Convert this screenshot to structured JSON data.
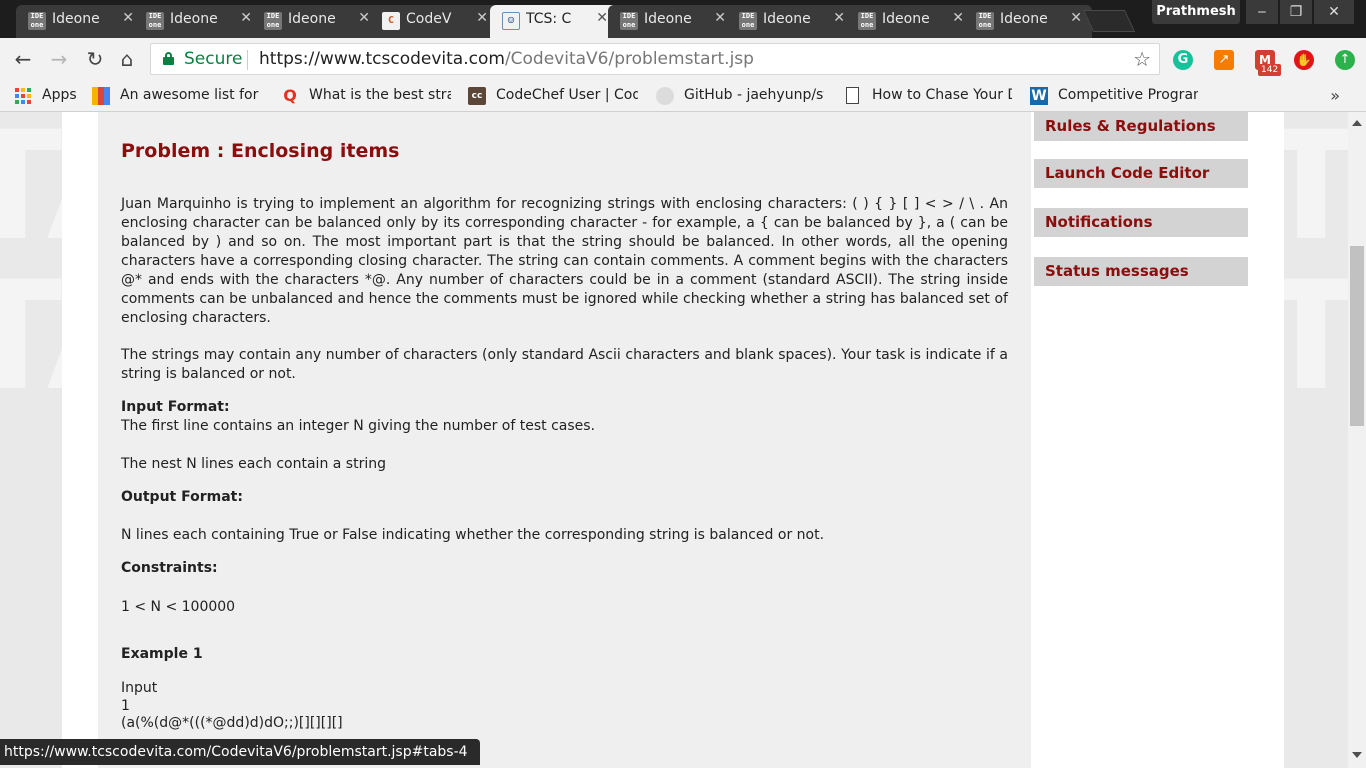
{
  "browser": {
    "tabs": [
      {
        "title": "Ideone",
        "favicon": "ideone-icon",
        "favicon_text": "IDE one",
        "active": false
      },
      {
        "title": "Ideone",
        "favicon": "ideone-icon",
        "favicon_text": "IDE one",
        "active": false
      },
      {
        "title": "Ideone",
        "favicon": "ideone-icon",
        "favicon_text": "IDE one",
        "active": false
      },
      {
        "title": "CodeV",
        "favicon": "codechef-icon",
        "favicon_text": "C",
        "active": false
      },
      {
        "title": "TCS: C",
        "favicon": "tcs-icon",
        "favicon_text": "☺",
        "active": true
      },
      {
        "title": "Ideone",
        "favicon": "ideone-icon",
        "favicon_text": "IDE one",
        "active": false
      },
      {
        "title": "Ideone",
        "favicon": "ideone-icon",
        "favicon_text": "IDE one",
        "active": false
      },
      {
        "title": "Ideone",
        "favicon": "ideone-icon",
        "favicon_text": "IDE one",
        "active": false
      },
      {
        "title": "Ideone",
        "favicon": "ideone-icon",
        "favicon_text": "IDE one",
        "active": false
      }
    ],
    "profile_name": "Prathmesh",
    "window_controls": {
      "minimize": "‒",
      "maximize": "❐",
      "close": "✕"
    },
    "toolbar": {
      "secure_label": "Secure",
      "url_host": "https://www.tcscodevita.com",
      "url_path": "/CodevitaV6/problemstart.jsp",
      "mail_badge": "142",
      "extensions": [
        "grammarly-icon",
        "chart-icon",
        "gmail-icon",
        "adblock-icon",
        "update-arrow-icon"
      ]
    },
    "bookmarks": [
      {
        "label": "Apps",
        "icon": "apps-grid-icon"
      },
      {
        "label": "An awesome list for c",
        "icon": "bar-chart-icon"
      },
      {
        "label": "What is the best strat",
        "icon": "quora-icon"
      },
      {
        "label": "CodeChef User | Code",
        "icon": "codechef-icon"
      },
      {
        "label": "GitHub - jaehyunp/st",
        "icon": "github-icon"
      },
      {
        "label": "How to Chase Your D",
        "icon": "page-icon"
      },
      {
        "label": "Competitive Program",
        "icon": "w-icon"
      }
    ],
    "bookmarks_overflow": "»",
    "status_url": "https://www.tcscodevita.com/CodevitaV6/problemstart.jsp#tabs-4"
  },
  "problem": {
    "title": "Problem : Enclosing items",
    "description": [
      "Juan Marquinho is trying to implement an algorithm for recognizing strings with enclosing characters:  ( ) { } [ ] < >   / \\ . An enclosing character can be balanced only by its corresponding character - for example, a { can be balanced by }, a ( can be balanced by ) and so on. The most important part is that the string should be balanced. In other words, all the opening characters have a corresponding closing character. The string can contain comments. A comment begins with the characters @* and ends with the characters *@. Any  number of characters could be in a comment (standard ASCII). The string inside comments can be unbalanced and hence the comments must be ignored while checking whether a string has balanced set of enclosing characters.",
      "The strings may contain any number of characters (only standard Ascii characters and blank spaces). Your task is indicate if a string is balanced or not."
    ],
    "input_format_heading": "Input Format:",
    "input_format_lines": [
      "The first line contains an integer N giving the number of test cases.",
      "The nest N lines each contain a string"
    ],
    "output_format_heading": "Output Format:",
    "output_format_text": "N lines each containing True or False indicating whether the corresponding string is balanced or not.",
    "constraints_heading": "Constraints:",
    "constraints_text": "1 < N < 100000",
    "example_heading": "Example 1",
    "example_input_label": "Input",
    "example_input_lines": [
      "1",
      "(a(%(d@*(((*@dd)d)dO;;)[][][][]"
    ]
  },
  "sidebar": {
    "items": [
      {
        "label": "Rules & Regulations"
      },
      {
        "label": "Launch Code Editor"
      },
      {
        "label": "Notifications"
      },
      {
        "label": "Status messages"
      }
    ]
  },
  "colors": {
    "accent": "#8b0d0d",
    "secure_green": "#0b8043",
    "content_bg": "#efefef",
    "sidebar_item_bg": "#d3d3d3"
  }
}
